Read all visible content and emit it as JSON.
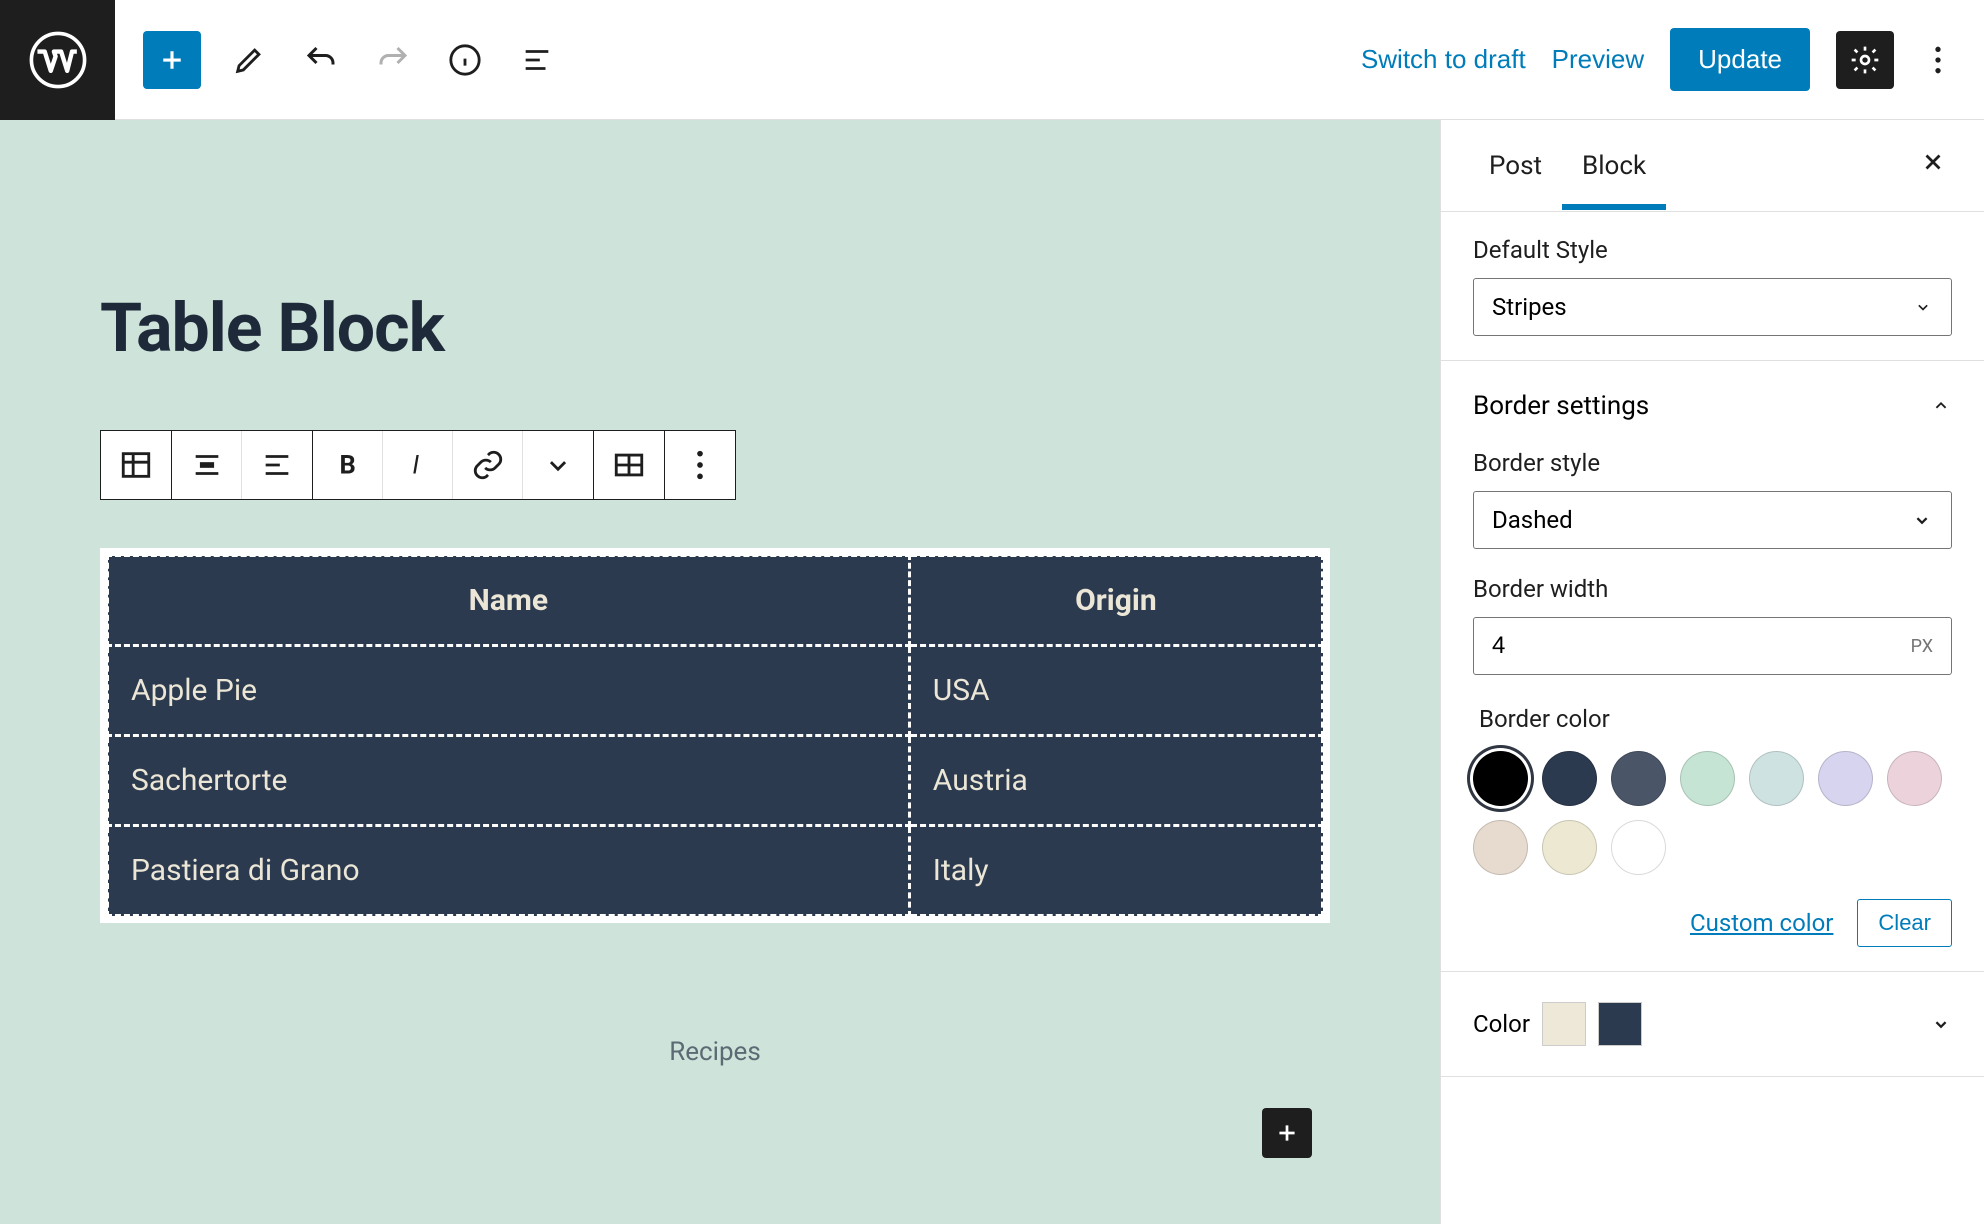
{
  "topbar": {
    "switch_draft": "Switch to draft",
    "preview": "Preview",
    "update": "Update"
  },
  "post_title": "Table Block",
  "table": {
    "headers": [
      "Name",
      "Origin"
    ],
    "rows": [
      [
        "Apple Pie",
        "USA"
      ],
      [
        "Sachertorte",
        "Austria"
      ],
      [
        "Pastiera di Grano",
        "Italy"
      ]
    ],
    "caption": "Recipes"
  },
  "sidebar": {
    "tabs": {
      "post": "Post",
      "block": "Block"
    },
    "default_style": {
      "label": "Default Style",
      "value": "Stripes"
    },
    "border_settings": {
      "title": "Border settings",
      "style": {
        "label": "Border style",
        "value": "Dashed"
      },
      "width": {
        "label": "Border width",
        "value": "4",
        "unit": "PX"
      },
      "color": {
        "label": "Border color",
        "swatches": [
          "#000000",
          "#2c3a4f",
          "#4a5668",
          "#c5e4d4",
          "#cfe2e2",
          "#d6d4ee",
          "#ecd3db",
          "#e6dbce",
          "#ece8d2",
          "#ffffff"
        ],
        "custom": "Custom color",
        "clear": "Clear"
      }
    },
    "color_section": {
      "label": "Color",
      "chips": [
        "#eee8d8",
        "#2c3a4f"
      ]
    }
  }
}
